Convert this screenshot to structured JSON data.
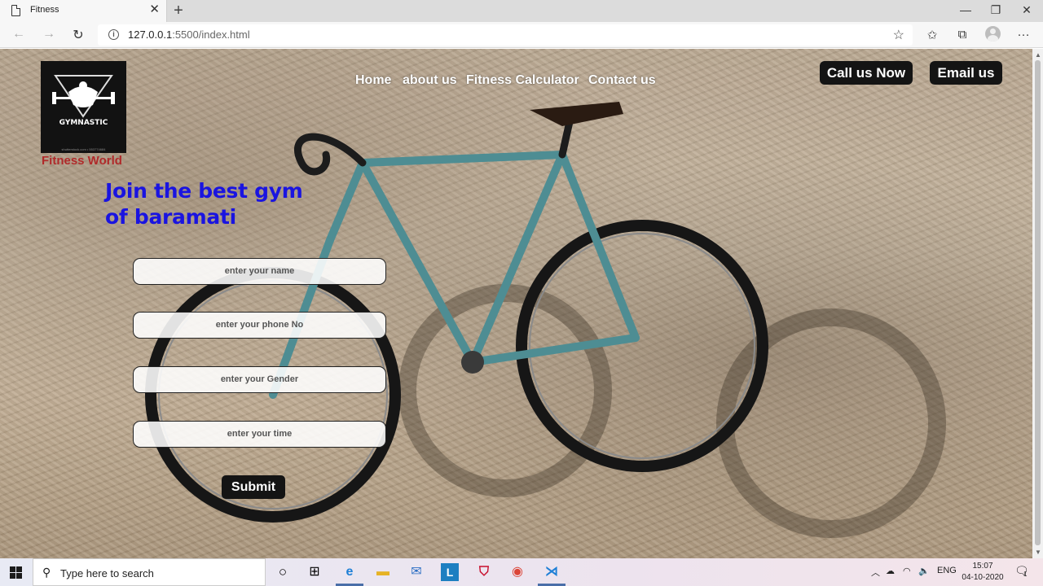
{
  "browser": {
    "tab_title": "Fitness",
    "url_host": "127.0.0.1",
    "url_rest": ":5500/index.html"
  },
  "site": {
    "logo_text": "GYMNASTIC",
    "logo_subtext": "shutterstock.com • 553774684",
    "brand_name": "Fitness World",
    "nav": [
      "Home",
      "about us",
      "Fitness Calculator",
      "Contact us"
    ],
    "call_button": "Call us Now",
    "email_button": "Email us",
    "headline": "Join the best gym of baramati",
    "form": {
      "name_placeholder": "enter your name",
      "phone_placeholder": "enter your phone No",
      "gender_placeholder": "enter your Gender",
      "time_placeholder": "enter your time",
      "submit_label": "Submit"
    }
  },
  "taskbar": {
    "search_placeholder": "Type here to search",
    "language": "ENG",
    "time": "15:07",
    "date": "04-10-2020",
    "notification_count": "1"
  }
}
